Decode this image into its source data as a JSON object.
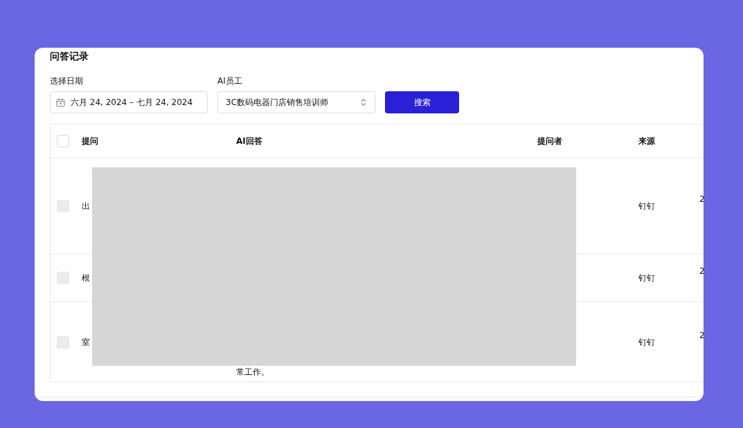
{
  "title": "问答记录",
  "filters": {
    "date": {
      "label": "选择日期",
      "value": "六月 24, 2024 – 七月 24, 2024"
    },
    "employee": {
      "label": "AI员工",
      "value": "3C数码电器门店销售培训师"
    },
    "search_button": "搜索"
  },
  "table": {
    "select_all": {
      "checked": false,
      "disabled": false
    },
    "columns": [
      "提问",
      "AI回答",
      "提问者",
      "来源"
    ],
    "rows": [
      {
        "checked": false,
        "disabled": true,
        "question": "出",
        "source": "钉钉",
        "column_6": "2"
      },
      {
        "checked": false,
        "disabled": true,
        "question": "根",
        "source": "钉钉",
        "column_6": "2"
      },
      {
        "checked": false,
        "disabled": true,
        "question": "室",
        "answer": "常工作。",
        "source": "钉钉",
        "column_6": "2"
      }
    ]
  }
}
